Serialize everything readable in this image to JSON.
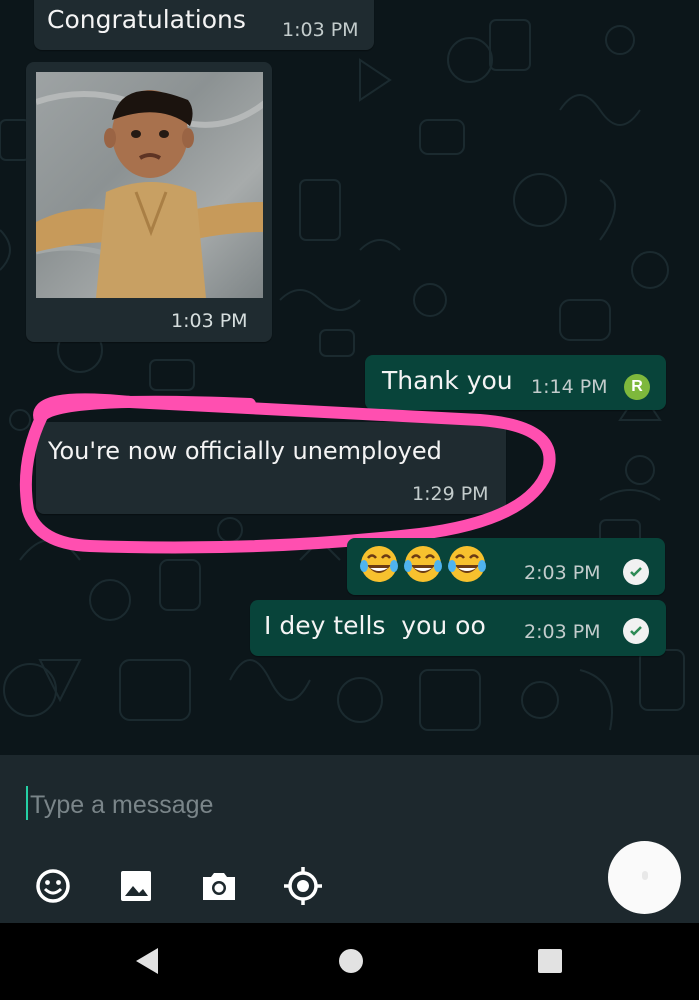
{
  "messages": [
    {
      "id": "m1",
      "direction": "incoming",
      "text": "Congratulations",
      "time": "1:03 PM"
    },
    {
      "id": "m2",
      "direction": "incoming",
      "type": "image",
      "image_icon": "photo-of-child-image",
      "time": "1:03 PM"
    },
    {
      "id": "m3",
      "direction": "outgoing",
      "text": "Thank you",
      "time": "1:14 PM",
      "badge": "R"
    },
    {
      "id": "m4",
      "direction": "incoming",
      "text": "You're now officially unemployed",
      "time": "1:29 PM",
      "highlighted": true
    },
    {
      "id": "m5",
      "direction": "outgoing",
      "type": "emoji",
      "text": "😂😂😂",
      "emoji_icon": "tears-of-joy-emoji",
      "time": "2:03 PM",
      "status_icon": "check-circle-icon"
    },
    {
      "id": "m6",
      "direction": "outgoing",
      "text": "I dey tells  you oo",
      "time": "2:03 PM",
      "status_icon": "check-circle-icon"
    }
  ],
  "composer": {
    "placeholder": "Type a message",
    "tools": [
      "emoji-icon",
      "gallery-icon",
      "camera-icon",
      "location-icon"
    ],
    "send_icon": "send-icon"
  },
  "navbar": {
    "buttons": [
      "back-icon",
      "home-icon",
      "recents-icon"
    ]
  },
  "colors": {
    "chat_background": "#0c161a",
    "incoming_bubble": "#1f2b30",
    "outgoing_bubble": "#08443a",
    "highlight_stroke": "#ff4fb0",
    "read_badge": "#7eb83c",
    "cursor": "#25d0a5"
  }
}
